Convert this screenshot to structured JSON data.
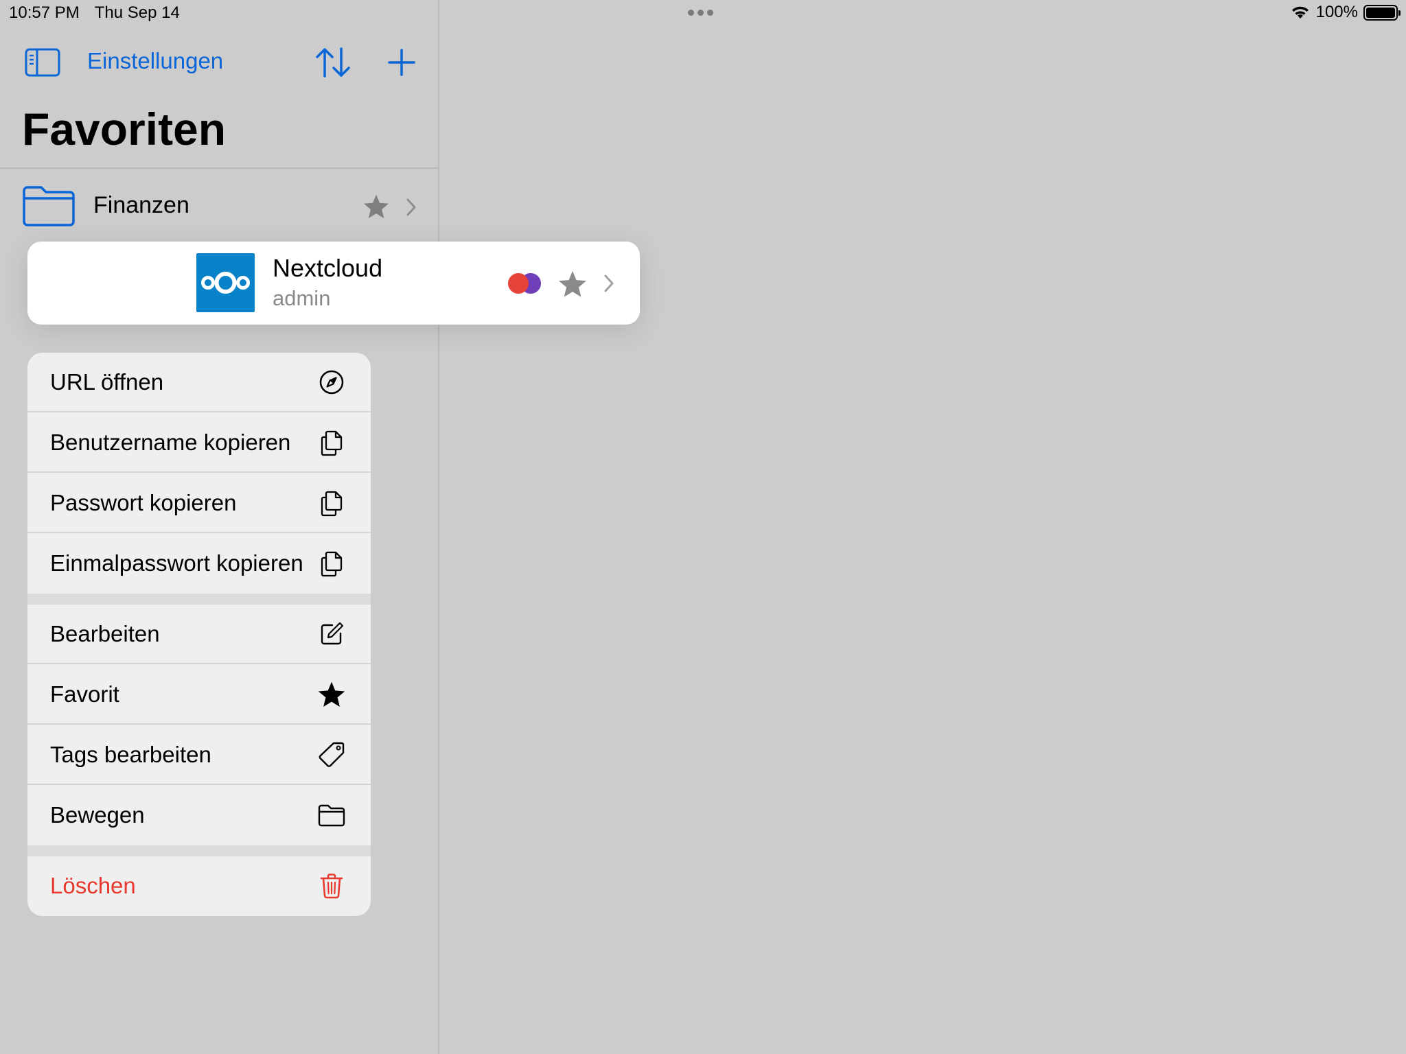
{
  "status_bar": {
    "time": "10:57 PM",
    "date": "Thu Sep 14",
    "battery_percent": "100%",
    "wifi_icon": "wifi-icon",
    "battery_icon": "battery-icon"
  },
  "nav": {
    "sidebar_icon": "sidebar-toggle-icon",
    "settings_label": "Einstellungen",
    "sort_icon": "sort-icon",
    "add_icon": "plus-icon"
  },
  "page": {
    "title": "Favoriten"
  },
  "folders": [
    {
      "name": "Finanzen",
      "icon": "folder-icon",
      "favorite": true
    }
  ],
  "selected_entry": {
    "title": "Nextcloud",
    "subtitle": "admin",
    "logo": "nextcloud-logo",
    "tag_colors": [
      "#e6443a",
      "#6e3fb8"
    ],
    "favorite": true
  },
  "context_menu": {
    "groups": [
      [
        {
          "label": "URL öffnen",
          "icon": "compass-icon"
        },
        {
          "label": "Benutzername kopieren",
          "icon": "copy-icon"
        },
        {
          "label": "Passwort kopieren",
          "icon": "copy-icon"
        },
        {
          "label": "Einmalpasswort kopieren",
          "icon": "copy-icon"
        }
      ],
      [
        {
          "label": "Bearbeiten",
          "icon": "edit-icon"
        },
        {
          "label": "Favorit",
          "icon": "star-icon"
        },
        {
          "label": "Tags bearbeiten",
          "icon": "tag-icon"
        },
        {
          "label": "Bewegen",
          "icon": "folder-icon"
        }
      ],
      [
        {
          "label": "Löschen",
          "icon": "trash-icon",
          "destructive": true
        }
      ]
    ]
  },
  "colors": {
    "accent": "#0a66d8",
    "destructive": "#e8392f",
    "nextcloud_blue": "#0882c9",
    "background": "#cccccc"
  }
}
